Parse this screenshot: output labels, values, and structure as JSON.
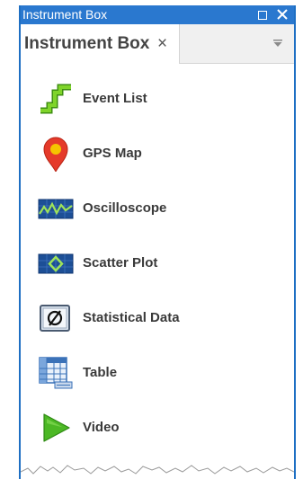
{
  "window": {
    "title": "Instrument Box",
    "maximize_icon": "maximize-icon",
    "close_icon": "close-icon"
  },
  "tab": {
    "label": "Instrument Box",
    "close_glyph": "×",
    "dropdown_icon": "dropdown-arrow-icon"
  },
  "instruments": [
    {
      "label": "Event List",
      "icon": "event-list-icon"
    },
    {
      "label": "GPS Map",
      "icon": "map-pin-icon"
    },
    {
      "label": "Oscilloscope",
      "icon": "oscilloscope-icon"
    },
    {
      "label": "Scatter Plot",
      "icon": "scatter-plot-icon"
    },
    {
      "label": "Statistical Data",
      "icon": "statistical-data-icon"
    },
    {
      "label": "Table",
      "icon": "table-icon"
    },
    {
      "label": "Video",
      "icon": "play-icon"
    }
  ],
  "colors": {
    "titlebar": "#2a78cf",
    "border": "#1e6fc3",
    "event_green": "#6cc51f",
    "gps_red": "#e53a2a",
    "gps_yellow": "#f5c400",
    "video_green": "#4cb825"
  }
}
